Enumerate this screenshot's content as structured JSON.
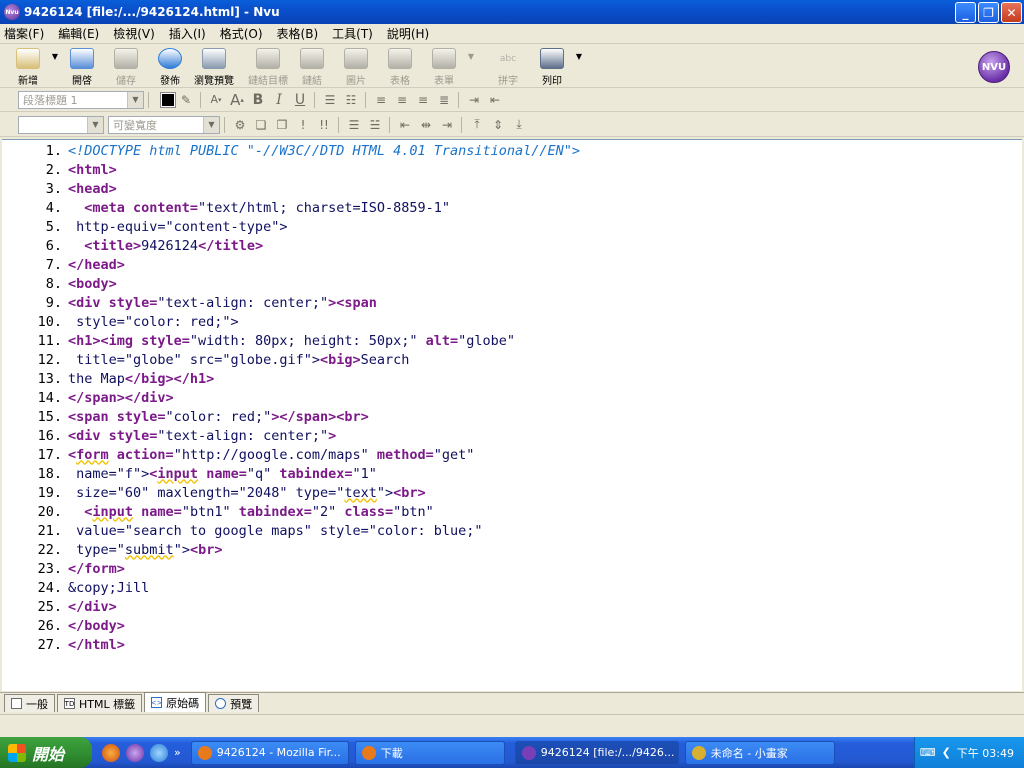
{
  "window": {
    "title": "9426124 [file:/.../9426124.html] - Nvu",
    "app_icon_text": "Nvu"
  },
  "menu": [
    {
      "label": "檔案(F)"
    },
    {
      "label": "編輯(E)"
    },
    {
      "label": "檢視(V)"
    },
    {
      "label": "插入(I)"
    },
    {
      "label": "格式(O)"
    },
    {
      "label": "表格(B)"
    },
    {
      "label": "工具(T)"
    },
    {
      "label": "說明(H)"
    }
  ],
  "toolbar": [
    {
      "label": "新增",
      "icon": "new-page-icon",
      "enabled": true,
      "color": "#d8c079"
    },
    {
      "label": "開啓",
      "icon": "open-folder-icon",
      "enabled": true,
      "color": "#5a8fd8"
    },
    {
      "label": "儲存",
      "icon": "save-disk-icon",
      "enabled": false,
      "color": "#6d6d6d"
    },
    {
      "label": "發佈",
      "icon": "publish-globe-icon",
      "enabled": true,
      "color": "#2f7bd6"
    },
    {
      "label": "瀏覽預覽",
      "icon": "browse-magnifier-icon",
      "enabled": true,
      "color": "#8a9bb0"
    },
    {
      "label": "鏈結目標",
      "icon": "anchor-icon",
      "enabled": false,
      "color": "#6d6d6d"
    },
    {
      "label": "鏈結",
      "icon": "link-icon",
      "enabled": false,
      "color": "#6d6d6d"
    },
    {
      "label": "圖片",
      "icon": "image-icon",
      "enabled": false,
      "color": "#6d6d6d"
    },
    {
      "label": "表格",
      "icon": "table-icon",
      "enabled": false,
      "color": "#6d6d6d"
    },
    {
      "label": "表單",
      "icon": "form-icon",
      "enabled": false,
      "color": "#6d6d6d"
    },
    {
      "label": "拼字",
      "icon": "spell-check-icon",
      "enabled": false,
      "color": "#6d6d6d"
    },
    {
      "label": "列印",
      "icon": "print-icon",
      "enabled": true,
      "color": "#5d6f8a"
    }
  ],
  "toolbar_extra": {
    "spell_icon_text": "abc",
    "logo_text": "NVU"
  },
  "format1": {
    "paragraph_select": "段落標題 1"
  },
  "format2": {
    "font_select": "",
    "width_select": "可變寬度"
  },
  "code_lines": [
    {
      "n": "1.",
      "segs": [
        {
          "t": "<!DOCTYPE html PUBLIC \"-//W3C//DTD HTML 4.01 Transitional//EN\">",
          "k": "doc"
        }
      ]
    },
    {
      "n": "2.",
      "segs": [
        {
          "t": "<html>",
          "k": "tag"
        }
      ]
    },
    {
      "n": "3.",
      "segs": [
        {
          "t": "<head>",
          "k": "tag"
        }
      ]
    },
    {
      "n": "4.",
      "segs": [
        {
          "t": "  <meta content=",
          "k": "tag"
        },
        {
          "t": "\"text/html; charset=ISO-8859-1\"",
          "k": "val"
        }
      ]
    },
    {
      "n": "5.",
      "segs": [
        {
          "t": " http-equiv=\"content-type\">",
          "k": "val"
        }
      ]
    },
    {
      "n": "6.",
      "segs": [
        {
          "t": "  <title>",
          "k": "tag"
        },
        {
          "t": "9426124",
          "k": "val"
        },
        {
          "t": "</title>",
          "k": "tag"
        }
      ]
    },
    {
      "n": "7.",
      "segs": [
        {
          "t": "</head>",
          "k": "tag"
        }
      ]
    },
    {
      "n": "8.",
      "segs": [
        {
          "t": "<body>",
          "k": "tag"
        }
      ]
    },
    {
      "n": "9.",
      "segs": [
        {
          "t": "<div style=",
          "k": "tag"
        },
        {
          "t": "\"text-align: center;\"",
          "k": "val"
        },
        {
          "t": "><span",
          "k": "tag"
        }
      ]
    },
    {
      "n": "10.",
      "segs": [
        {
          "t": " style=\"color: red;\">",
          "k": "val"
        }
      ]
    },
    {
      "n": "11.",
      "segs": [
        {
          "t": "<h1><img style=",
          "k": "tag"
        },
        {
          "t": "\"width: 80px; height: 50px;\"",
          "k": "val"
        },
        {
          "t": " alt=",
          "k": "tag"
        },
        {
          "t": "\"globe\"",
          "k": "val"
        }
      ]
    },
    {
      "n": "12.",
      "segs": [
        {
          "t": " title=\"globe\" src=\"globe.gif\">",
          "k": "val"
        },
        {
          "t": "<big>",
          "k": "tag"
        },
        {
          "t": "Search",
          "k": "val"
        }
      ]
    },
    {
      "n": "13.",
      "segs": [
        {
          "t": "the Map",
          "k": "val"
        },
        {
          "t": "</big></h1>",
          "k": "tag"
        }
      ]
    },
    {
      "n": "14.",
      "segs": [
        {
          "t": "</span></div>",
          "k": "tag"
        }
      ]
    },
    {
      "n": "15.",
      "segs": [
        {
          "t": "<span style=",
          "k": "tag"
        },
        {
          "t": "\"color: red;\"",
          "k": "val"
        },
        {
          "t": "></span><br>",
          "k": "tag"
        }
      ]
    },
    {
      "n": "16.",
      "segs": [
        {
          "t": "<div style=",
          "k": "tag"
        },
        {
          "t": "\"text-align: center;\"",
          "k": "val"
        },
        {
          "t": ">",
          "k": "tag"
        }
      ]
    },
    {
      "n": "17.",
      "segs": [
        {
          "t": "<",
          "k": "tag"
        },
        {
          "t": "form",
          "k": "tagsq"
        },
        {
          "t": " action=",
          "k": "tag"
        },
        {
          "t": "\"http://google.com/maps\"",
          "k": "val"
        },
        {
          "t": " method=",
          "k": "tag"
        },
        {
          "t": "\"get\"",
          "k": "val"
        }
      ]
    },
    {
      "n": "18.",
      "segs": [
        {
          "t": " name=\"f\">",
          "k": "val"
        },
        {
          "t": "<",
          "k": "tag"
        },
        {
          "t": "input",
          "k": "tagsq"
        },
        {
          "t": " name=",
          "k": "tag"
        },
        {
          "t": "\"q\"",
          "k": "val"
        },
        {
          "t": " tabindex=",
          "k": "tag"
        },
        {
          "t": "\"1\"",
          "k": "val"
        }
      ]
    },
    {
      "n": "19.",
      "segs": [
        {
          "t": " size=\"60\" maxlength=\"2048\" type=\"",
          "k": "val"
        },
        {
          "t": "text",
          "k": "valsq"
        },
        {
          "t": "\">",
          "k": "val"
        },
        {
          "t": "<br>",
          "k": "tag"
        }
      ]
    },
    {
      "n": "20.",
      "segs": [
        {
          "t": "  <",
          "k": "tag"
        },
        {
          "t": "input",
          "k": "tagsq"
        },
        {
          "t": " name=",
          "k": "tag"
        },
        {
          "t": "\"btn1\"",
          "k": "val"
        },
        {
          "t": " tabindex=",
          "k": "tag"
        },
        {
          "t": "\"2\"",
          "k": "val"
        },
        {
          "t": " class=",
          "k": "tag"
        },
        {
          "t": "\"btn\"",
          "k": "val"
        }
      ]
    },
    {
      "n": "21.",
      "segs": [
        {
          "t": " value=\"search to google maps\" style=\"color: blue;\"",
          "k": "val"
        }
      ]
    },
    {
      "n": "22.",
      "segs": [
        {
          "t": " type=\"",
          "k": "val"
        },
        {
          "t": "submit",
          "k": "valsq"
        },
        {
          "t": "\">",
          "k": "val"
        },
        {
          "t": "<br>",
          "k": "tag"
        }
      ]
    },
    {
      "n": "23.",
      "segs": [
        {
          "t": "</form>",
          "k": "tag"
        }
      ]
    },
    {
      "n": "24.",
      "segs": [
        {
          "t": "&copy;Jill",
          "k": "val"
        }
      ]
    },
    {
      "n": "25.",
      "segs": [
        {
          "t": "</div>",
          "k": "tag"
        }
      ]
    },
    {
      "n": "26.",
      "segs": [
        {
          "t": "</body>",
          "k": "tag"
        }
      ]
    },
    {
      "n": "27.",
      "segs": [
        {
          "t": "</html>",
          "k": "tag"
        }
      ]
    }
  ],
  "tabs": [
    {
      "label": "一般",
      "icon": "page-icon",
      "active": false
    },
    {
      "label": "HTML 標籤",
      "icon": "td-tag-icon",
      "icon_text": "TD",
      "active": false
    },
    {
      "label": "原始碼",
      "icon": "source-code-icon",
      "icon_text": "<>",
      "active": true
    },
    {
      "label": "預覽",
      "icon": "preview-magnifier-icon",
      "active": false
    }
  ],
  "taskbar": {
    "start_label": "開始",
    "tasks": [
      {
        "label": "9426124 - Mozilla Fir...",
        "icon": "firefox-icon",
        "color": "#e87a1c",
        "active": false
      },
      {
        "label": "下載",
        "icon": "firefox-download-icon",
        "color": "#e87a1c",
        "active": false
      },
      {
        "label": "9426124 [file:/.../9426...",
        "icon": "nvu-icon",
        "color": "#7a3fb8",
        "active": true
      },
      {
        "label": "未命名 - 小畫家",
        "icon": "paint-icon",
        "color": "#d8b030",
        "active": false
      }
    ],
    "clock": "下午 03:49"
  }
}
